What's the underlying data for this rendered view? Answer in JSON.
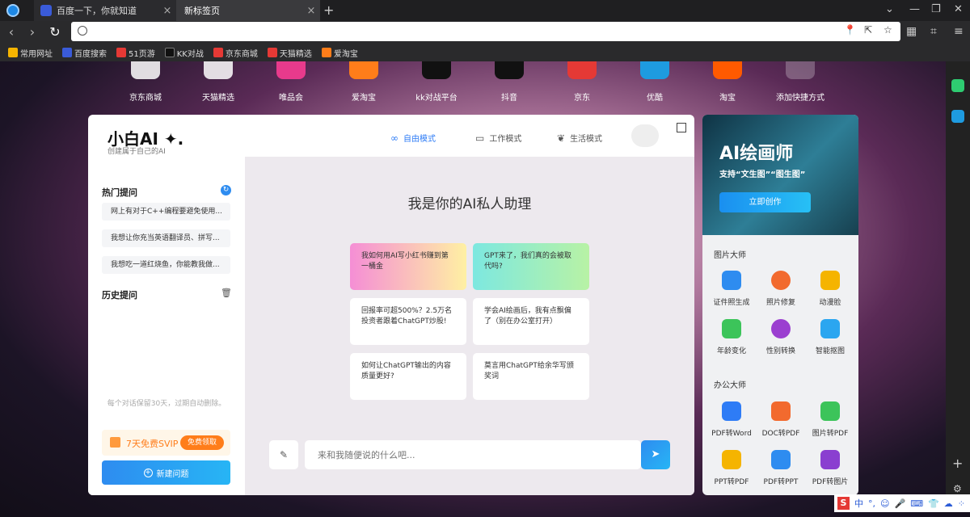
{
  "browser": {
    "tabs": [
      {
        "label": "百度一下，你就知道",
        "close": "×"
      },
      {
        "label": "新标签页",
        "close": "×"
      }
    ],
    "new_tab": "+",
    "window_controls": [
      "⌄",
      "—",
      "❐",
      "✕"
    ],
    "nav": {
      "back": "‹",
      "forward": "›",
      "refresh": "↻"
    },
    "address": {
      "value": "",
      "placeholder": ""
    },
    "address_icons": [
      "📍",
      "⇱",
      "☆"
    ],
    "bookmarks": [
      {
        "label": "常用网址",
        "color": "#f5b400"
      },
      {
        "label": "百度搜索",
        "color": "#3a5bd9"
      },
      {
        "label": "51页游",
        "color": "#e53935"
      },
      {
        "label": "KK对战",
        "color": "#111111"
      },
      {
        "label": "京东商城",
        "color": "#e53935"
      },
      {
        "label": "天猫精选",
        "color": "#e53935"
      },
      {
        "label": "爱淘宝",
        "color": "#ff7d1a"
      }
    ]
  },
  "shortcuts": [
    "京东商城",
    "天猫精选",
    "唯品会",
    "爱淘宝",
    "kk对战平台",
    "抖音",
    "京东",
    "优酷",
    "淘宝",
    "添加快捷方式"
  ],
  "assistant": {
    "brand_title": "小白AI ✦.",
    "brand_subtitle": "创建属于自己的AI",
    "modes": [
      {
        "label": "自由模式",
        "icon": "∞"
      },
      {
        "label": "工作模式",
        "icon": "▭"
      },
      {
        "label": "生活模式",
        "icon": "❦"
      }
    ],
    "expand_icon": "⤢",
    "hot_title": "热门提问",
    "refresh_icon": "↻",
    "hot_questions": [
      "网上有对于C++编程要避免使用...",
      "我想让你充当英语翻译员、拼写...",
      "我想吃一道红烧鱼，你能教我做..."
    ],
    "history_title": "历史提问",
    "trash_icon": "🗑",
    "retention_note": "每个对话保留30天，过期自动删除。",
    "svip_text": "7天免费SVIP",
    "svip_button": "免费领取",
    "new_question": "新建问题",
    "greeting": "我是你的AI私人助理",
    "suggestions": [
      "我如何用AI写小红书赚到第一桶金",
      "GPT来了，我们真的会被取代吗?",
      "回报率可超500%？2.5万名投资者跟着ChatGPT炒股!",
      "学会AI绘画后，我有点飘偏了（别在办公室打开）",
      "如何让ChatGPT输出的内容质量更好?",
      "莫言用ChatGPT给余华写颁奖词"
    ],
    "input_placeholder": "来和我随便说的什么吧...",
    "broom_icon": "✎",
    "send_icon": "➤"
  },
  "tools": {
    "banner_title": "AI绘画师",
    "banner_subtitle": "支持“文生图”“图生图”",
    "banner_button": "立即创作",
    "image_section": "图片大师",
    "image_tools": [
      {
        "label": "证件照生成",
        "color": "#2e8cf0"
      },
      {
        "label": "照片修复",
        "color": "#f26a2e"
      },
      {
        "label": "动漫脸",
        "color": "#f5b400"
      },
      {
        "label": "年龄变化",
        "color": "#3cc45a"
      },
      {
        "label": "性别转换",
        "color": "#9b3fd0"
      },
      {
        "label": "智能抠图",
        "color": "#2ba6f0"
      }
    ],
    "office_section": "办公大师",
    "office_tools": [
      {
        "label": "PDF转Word",
        "color": "#2e7cf6"
      },
      {
        "label": "DOC转PDF",
        "color": "#f26a2e"
      },
      {
        "label": "图片转PDF",
        "color": "#3cc45a"
      },
      {
        "label": "PPT转PDF",
        "color": "#f5b400"
      },
      {
        "label": "PDF转PPT",
        "color": "#2e8cf0"
      },
      {
        "label": "PDF转图片",
        "color": "#8a3fd0"
      }
    ]
  },
  "ime": {
    "logo": "S",
    "items": [
      "中",
      "°,",
      "☺",
      "🎤",
      "⌨",
      "👕",
      "☁",
      "⁘"
    ]
  }
}
